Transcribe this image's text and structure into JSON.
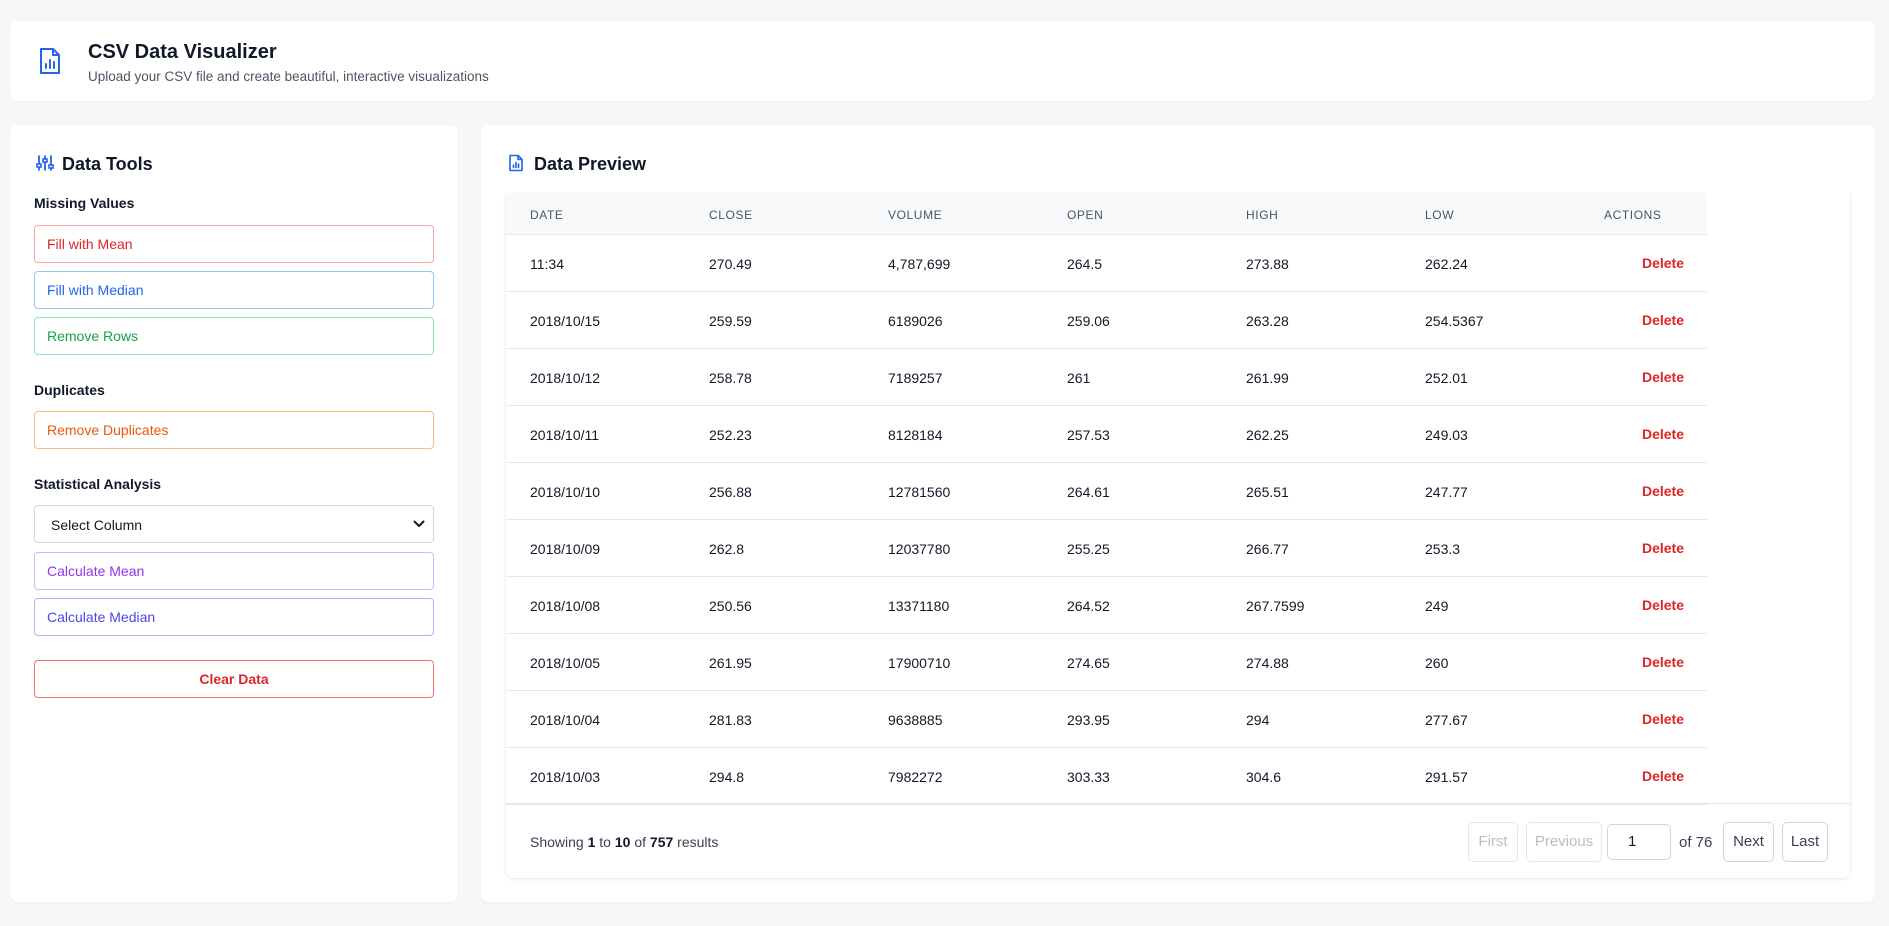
{
  "header": {
    "title": "CSV Data Visualizer",
    "subtitle": "Upload your CSV file and create beautiful, interactive visualizations",
    "icon": "file-chart-icon"
  },
  "sidebar": {
    "title": "Data Tools",
    "icon": "sliders-icon",
    "missing_values": {
      "label": "Missing Values",
      "fill_mean": "Fill with Mean",
      "fill_median": "Fill with Median",
      "remove_rows": "Remove Rows"
    },
    "duplicates": {
      "label": "Duplicates",
      "remove_duplicates": "Remove Duplicates"
    },
    "stats": {
      "label": "Statistical Analysis",
      "select_value": "Select Column",
      "calc_mean": "Calculate Mean",
      "calc_median": "Calculate Median"
    },
    "clear_label": "Clear Data"
  },
  "main": {
    "title": "Data Preview",
    "icon": "file-chart-icon",
    "columns": [
      "Date",
      "Close",
      "Volume",
      "Open",
      "High",
      "Low",
      "Actions"
    ],
    "delete_label": "Delete",
    "rows": [
      [
        "11:34",
        "270.49",
        "4,787,699",
        "264.5",
        "273.88",
        "262.24"
      ],
      [
        "2018/10/15",
        "259.59",
        "6189026",
        "259.06",
        "263.28",
        "254.5367"
      ],
      [
        "2018/10/12",
        "258.78",
        "7189257",
        "261",
        "261.99",
        "252.01"
      ],
      [
        "2018/10/11",
        "252.23",
        "8128184",
        "257.53",
        "262.25",
        "249.03"
      ],
      [
        "2018/10/10",
        "256.88",
        "12781560",
        "264.61",
        "265.51",
        "247.77"
      ],
      [
        "2018/10/09",
        "262.8",
        "12037780",
        "255.25",
        "266.77",
        "253.3"
      ],
      [
        "2018/10/08",
        "250.56",
        "13371180",
        "264.52",
        "267.7599",
        "249"
      ],
      [
        "2018/10/05",
        "261.95",
        "17900710",
        "274.65",
        "274.88",
        "260"
      ],
      [
        "2018/10/04",
        "281.83",
        "9638885",
        "293.95",
        "294",
        "277.67"
      ],
      [
        "2018/10/03",
        "294.8",
        "7982272",
        "303.33",
        "304.6",
        "291.57"
      ]
    ],
    "pagination": {
      "showing_prefix": "Showing",
      "from": "1",
      "to_word": "to",
      "to": "10",
      "of_word": "of",
      "total": "757",
      "results_word": "results",
      "first": "First",
      "previous": "Previous",
      "page": "1",
      "of_pages": "of 76",
      "next": "Next",
      "last": "Last"
    }
  },
  "colors": {
    "accent_blue": "#2563eb",
    "red": "#dc2626",
    "green": "#16a34a",
    "orange": "#ea580c",
    "purple": "#9333ea",
    "indigo": "#4f46e5"
  }
}
